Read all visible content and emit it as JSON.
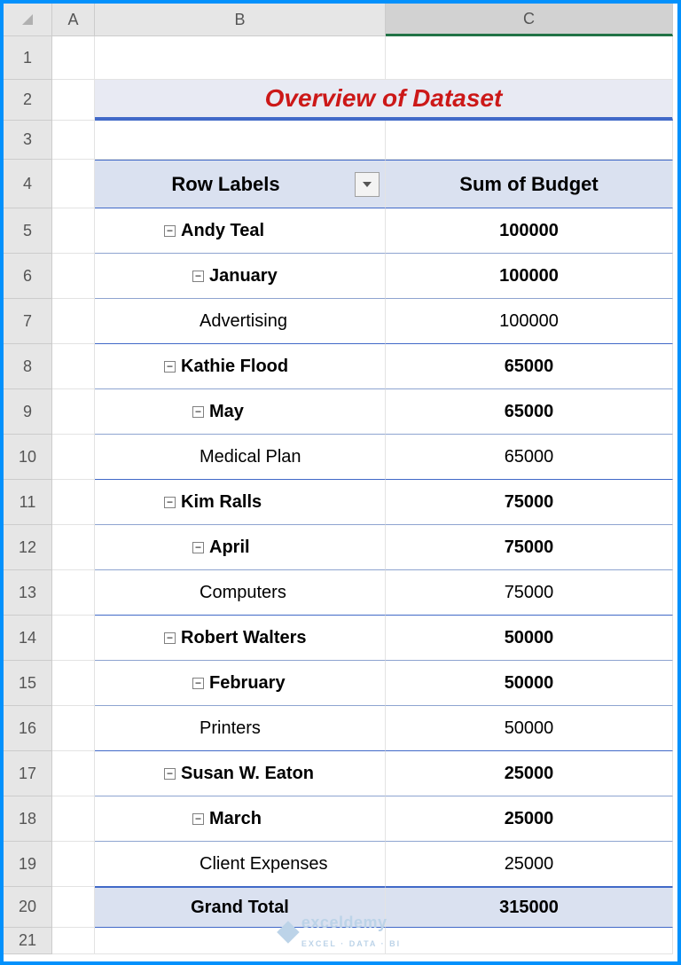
{
  "columns": {
    "a": "A",
    "b": "B",
    "c": "C"
  },
  "row_numbers": [
    "1",
    "2",
    "3",
    "4",
    "5",
    "6",
    "7",
    "8",
    "9",
    "10",
    "11",
    "12",
    "13",
    "14",
    "15",
    "16",
    "17",
    "18",
    "19",
    "20",
    "21"
  ],
  "title": "Overview of Dataset",
  "pivot_headers": {
    "row_labels": "Row Labels",
    "sum_budget": "Sum of Budget"
  },
  "rows": [
    {
      "label": "Andy Teal",
      "value": "100000",
      "bold": true,
      "indent": 1,
      "expand": true
    },
    {
      "label": "January",
      "value": "100000",
      "bold": true,
      "indent": 2,
      "expand": true
    },
    {
      "label": "Advertising",
      "value": "100000",
      "bold": false,
      "indent": 3,
      "expand": false
    },
    {
      "label": "Kathie Flood",
      "value": "65000",
      "bold": true,
      "indent": 1,
      "expand": true
    },
    {
      "label": "May",
      "value": "65000",
      "bold": true,
      "indent": 2,
      "expand": true
    },
    {
      "label": "Medical Plan",
      "value": "65000",
      "bold": false,
      "indent": 3,
      "expand": false
    },
    {
      "label": "Kim Ralls",
      "value": "75000",
      "bold": true,
      "indent": 1,
      "expand": true
    },
    {
      "label": "April",
      "value": "75000",
      "bold": true,
      "indent": 2,
      "expand": true
    },
    {
      "label": "Computers",
      "value": "75000",
      "bold": false,
      "indent": 3,
      "expand": false
    },
    {
      "label": "Robert Walters",
      "value": "50000",
      "bold": true,
      "indent": 1,
      "expand": true
    },
    {
      "label": "February",
      "value": "50000",
      "bold": true,
      "indent": 2,
      "expand": true
    },
    {
      "label": "Printers",
      "value": "50000",
      "bold": false,
      "indent": 3,
      "expand": false
    },
    {
      "label": "Susan W. Eaton",
      "value": "25000",
      "bold": true,
      "indent": 1,
      "expand": true
    },
    {
      "label": "March",
      "value": "25000",
      "bold": true,
      "indent": 2,
      "expand": true
    },
    {
      "label": "Client Expenses",
      "value": "25000",
      "bold": false,
      "indent": 3,
      "expand": false
    }
  ],
  "grand_total": {
    "label": "Grand Total",
    "value": "315000"
  },
  "watermark": {
    "name": "exceldemy",
    "sub": "EXCEL · DATA · BI"
  }
}
